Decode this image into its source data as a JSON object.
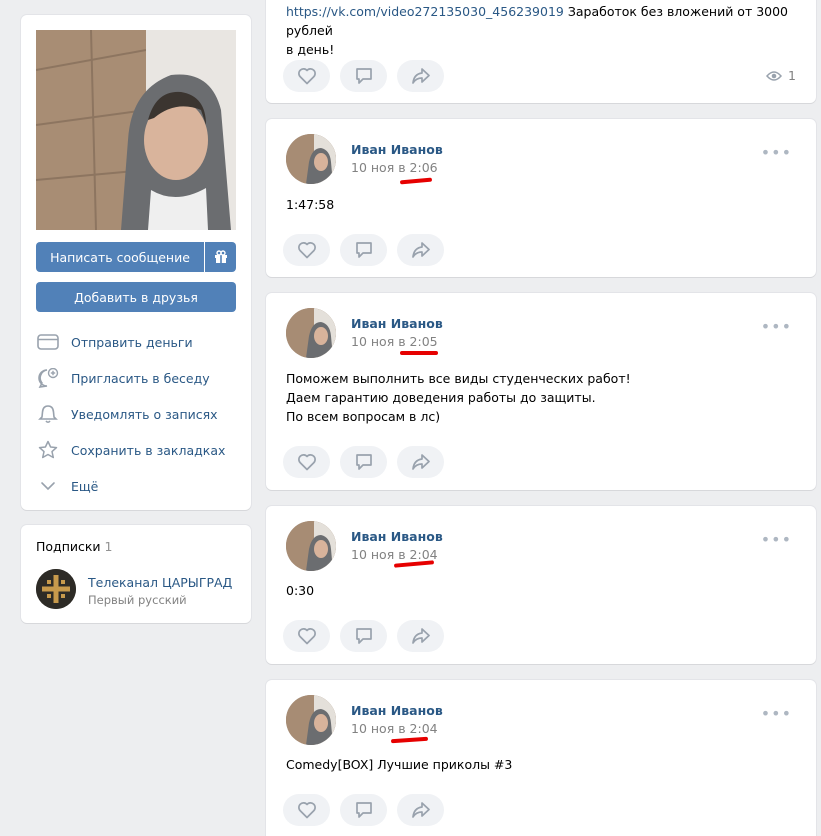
{
  "profile": {
    "message_button": "Написать сообщение",
    "gift_icon": "gift-icon",
    "add_friend_button": "Добавить в друзья",
    "actions": [
      {
        "icon": "card-icon",
        "label": "Отправить деньги"
      },
      {
        "icon": "chat-plus-icon",
        "label": "Пригласить в беседу"
      },
      {
        "icon": "bell-icon",
        "label": "Уведомлять о записях"
      },
      {
        "icon": "star-icon",
        "label": "Сохранить в закладках"
      },
      {
        "icon": "chevron-down-icon",
        "label": "Ещё"
      }
    ]
  },
  "subscriptions": {
    "title": "Подписки",
    "count": "1",
    "item": {
      "name": "Телеканал ЦАРЫГРАД",
      "subtitle": "Первый русский"
    }
  },
  "top_post": {
    "link": "https://vk.com/video272135030_456239019",
    "text_line1": " Заработок без вложений от 3000 рублей",
    "text_line2": "в день!",
    "views": "1"
  },
  "posts": [
    {
      "author": "Иван Иванов",
      "date": "10 ноя в 2:06",
      "text": "1:47:58"
    },
    {
      "author": "Иван Иванов",
      "date": "10 ноя в 2:05",
      "text": "Поможем выполнить все виды студенческих работ!\nДаем гарантию доведения работы до защиты.\nПо всем вопросам в лс)"
    },
    {
      "author": "Иван Иванов",
      "date": "10 ноя в 2:04",
      "text": "0:30"
    },
    {
      "author": "Иван Иванов",
      "date": "10 ноя в 2:04",
      "text": "Comedy[BOX] Лучшие приколы #3"
    }
  ],
  "more_icon": "•••",
  "colors": {
    "accent": "#5181b8",
    "link": "#2a5885",
    "highlight": "#e60000"
  }
}
